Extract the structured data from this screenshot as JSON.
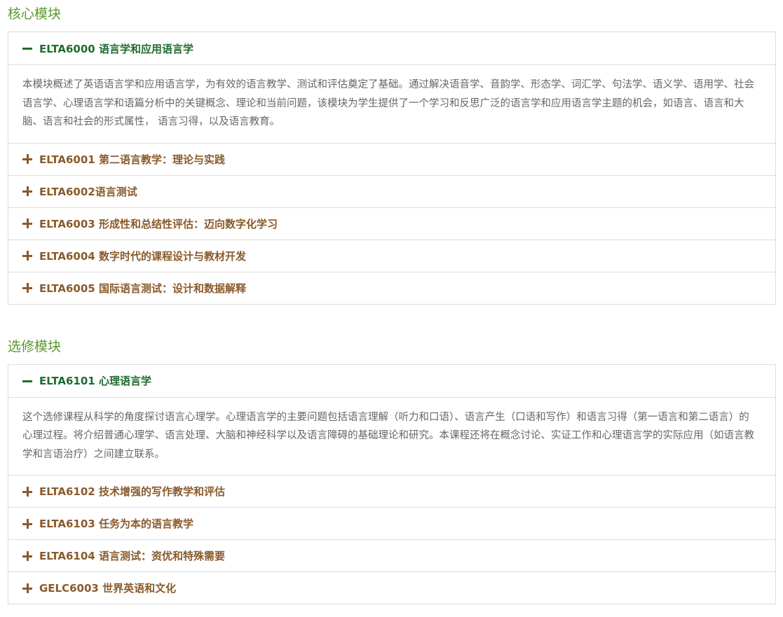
{
  "core": {
    "title": "核心模块",
    "open_item": {
      "label": "ELTA6000 语言学和应用语言学",
      "body": "本模块概述了英语语言学和应用语言学，为有效的语言教学、测试和评估奠定了基础。通过解决语音学、音韵学、形态学、词汇学、句法学、语义学、语用学、社会语言学、心理语言学和语篇分析中的关键概念、理论和当前问题，该模块为学生提供了一个学习和反思广泛的语言学和应用语言学主题的机会，如语言、语言和大脑、语言和社会的形式属性， 语言习得，以及语言教育。"
    },
    "items": [
      {
        "label": "ELTA6001 第二语言教学：理论与实践"
      },
      {
        "label": "ELTA6002语言测试"
      },
      {
        "label": "ELTA6003 形成性和总结性评估：迈向数字化学习"
      },
      {
        "label": "ELTA6004 数字时代的课程设计与教材开发"
      },
      {
        "label": "ELTA6005 国际语言测试：设计和数据解释"
      }
    ]
  },
  "elective": {
    "title": "选修模块",
    "open_item": {
      "label": "ELTA6101 心理语言学",
      "body": "这个选修课程从科学的角度探讨语言心理学。心理语言学的主要问题包括语言理解（听力和口语）、语言产生（口语和写作）和语言习得（第一语言和第二语言）的心理过程。将介绍普通心理学、语言处理、大脑和神经科学以及语言障碍的基础理论和研究。本课程还将在概念讨论、实证工作和心理语言学的实际应用（如语言教学和言语治疗）之间建立联系。"
    },
    "items": [
      {
        "label": "ELTA6102 技术增强的写作教学和评估"
      },
      {
        "label": "ELTA6103 任务为本的语言教学"
      },
      {
        "label": "ELTA6104 语言测试：资优和特殊需要"
      },
      {
        "label": "GELC6003 世界英语和文化"
      }
    ]
  },
  "colors": {
    "section_title": "#5a9a2a",
    "open_header": "#1f6b2e",
    "closed_header": "#8a5a2b",
    "border": "#dddddd"
  },
  "icons": {
    "open": "minus-icon",
    "closed": "plus-icon"
  }
}
